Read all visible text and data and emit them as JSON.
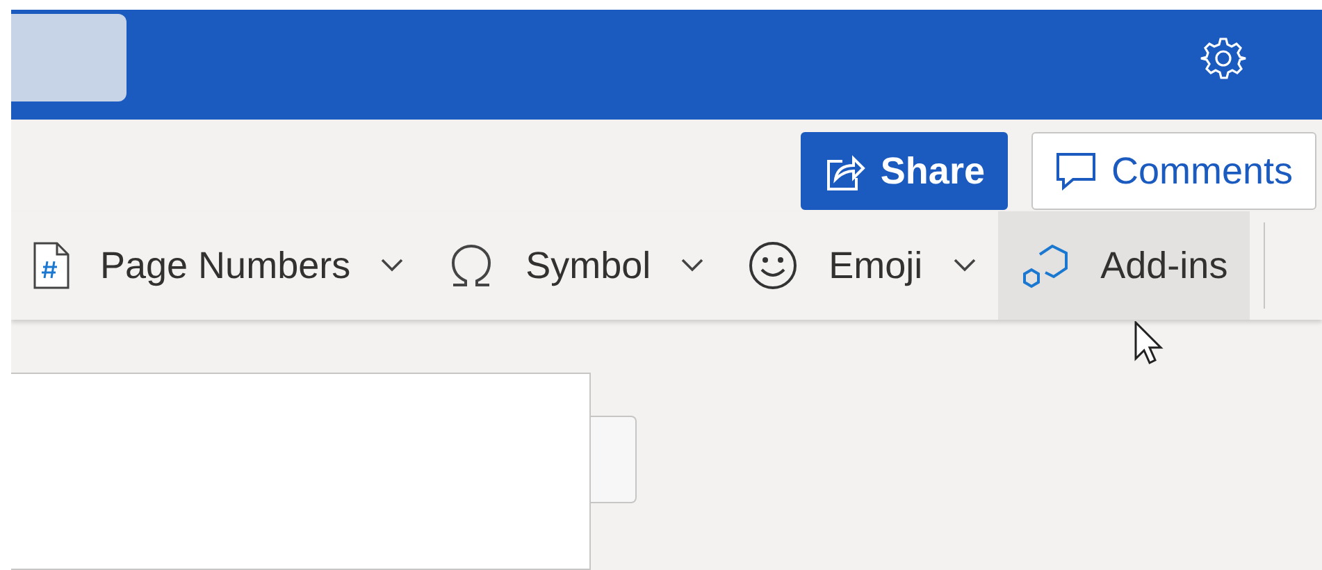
{
  "header": {
    "search_box": {
      "kind": "empty"
    }
  },
  "actions": [
    {
      "label": "Share",
      "kind": "primary"
    },
    {
      "label": "Comments",
      "kind": "outline"
    }
  ],
  "ribbon": {
    "items": [
      {
        "label": "Page Numbers",
        "kind": "page-number",
        "dropdown": true,
        "hovered": false
      },
      {
        "label": "Symbol",
        "kind": "omega",
        "dropdown": true,
        "hovered": false
      },
      {
        "label": "Emoji",
        "kind": "smiley",
        "dropdown": true,
        "hovered": false
      },
      {
        "label": "Add-ins",
        "kind": "addins",
        "dropdown": false,
        "hovered": true
      }
    ]
  }
}
